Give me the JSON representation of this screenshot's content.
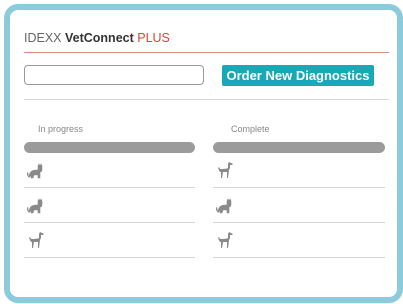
{
  "header": {
    "brand_idexx": "IDEXX ",
    "brand_vetconnect": "VetConnect",
    "brand_plus": " PLUS"
  },
  "search": {
    "value": "",
    "placeholder": ""
  },
  "actions": {
    "order_label": "Order New Diagnostics"
  },
  "columns": {
    "in_progress": {
      "title": "In progress",
      "rows": [
        {
          "icon": "cat-icon"
        },
        {
          "icon": "cat-icon"
        },
        {
          "icon": "dog-icon"
        }
      ]
    },
    "complete": {
      "title": "Complete",
      "rows": [
        {
          "icon": "dog-icon"
        },
        {
          "icon": "cat-icon"
        },
        {
          "icon": "dog-icon"
        }
      ]
    }
  },
  "colors": {
    "frame": "#8ccbdc",
    "accent": "#18a9b5",
    "brand_plus": "#d9453a",
    "placeholder_bar": "#9b9b9b",
    "icon": "#8a8a8a"
  }
}
